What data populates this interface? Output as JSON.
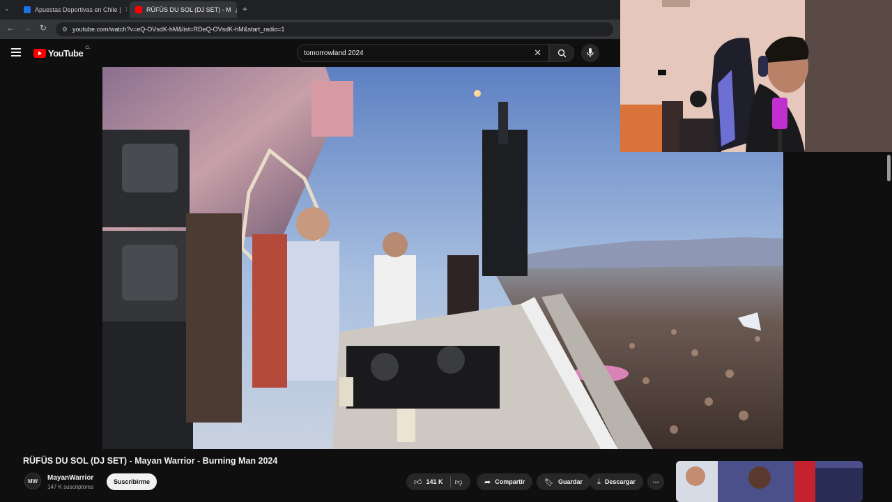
{
  "browser": {
    "tabs": [
      {
        "label": "Apuestas Deportivas en Chile |",
        "icon": "bet-site-icon"
      },
      {
        "label": "RÜFÜS DU SOL (DJ SET) - M",
        "icon": "youtube-icon"
      }
    ],
    "new_tab": "+",
    "url": "youtube.com/watch?v=eQ-OVsdK-hM&list=RDeQ-OVsdK-hM&start_radio=1"
  },
  "youtube": {
    "logo": "YouTube",
    "country": "CL",
    "search_value": "tomorrowland 2024"
  },
  "video": {
    "title": "RÜFÜS DU SOL (DJ SET) - Mayan Warrior - Burning Man 2024",
    "channel": "MayanWarrior",
    "channel_avatar": "MW",
    "subscribers": "147 K suscriptores",
    "subscribe_label": "Suscribirme",
    "likes": "141 K",
    "share_label": "Compartir",
    "save_label": "Guardar",
    "download_label": "Descargar",
    "more": "⋯"
  },
  "colors": {
    "youtube_red": "#ff0000",
    "background": "#0f0f0f",
    "pill": "#272727"
  }
}
